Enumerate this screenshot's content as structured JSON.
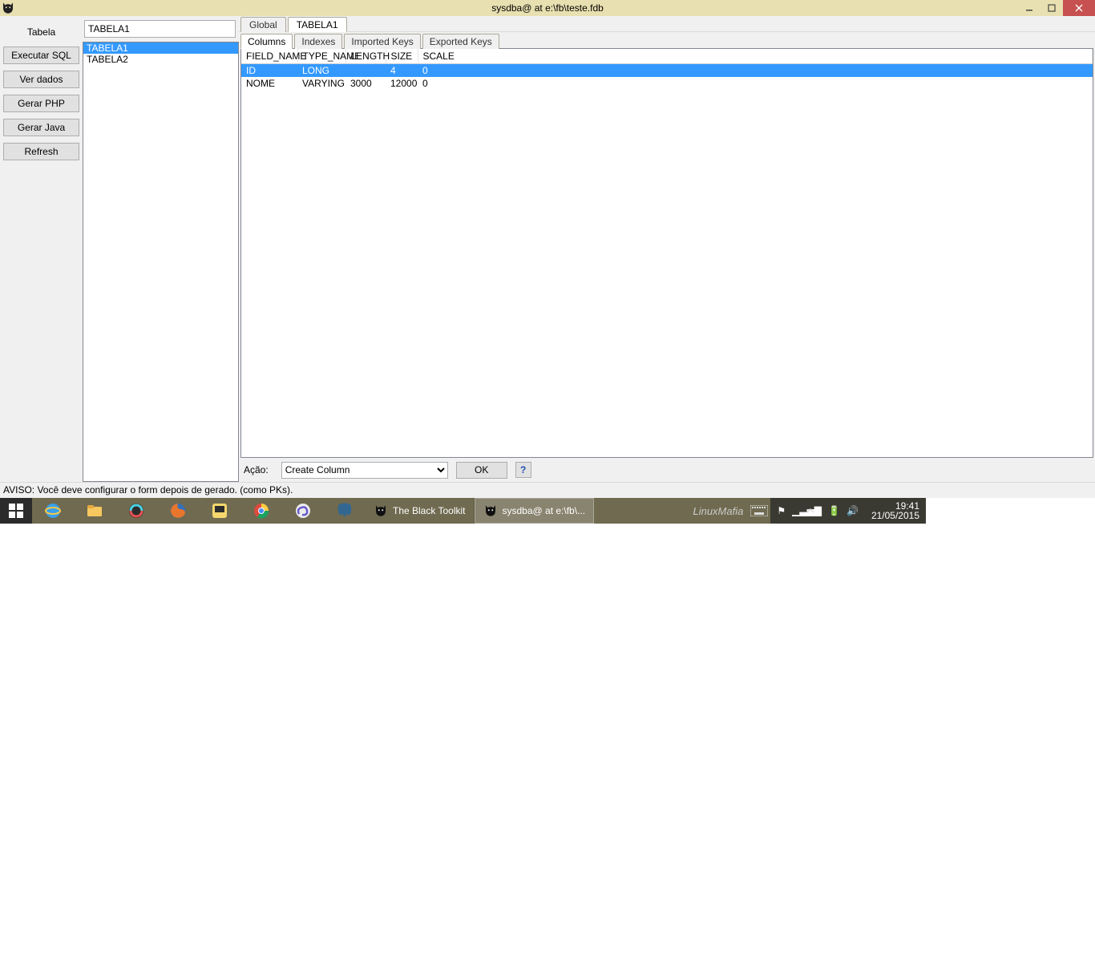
{
  "window": {
    "title": "sysdba@ at e:\\fb\\teste.fdb"
  },
  "sidebar": {
    "label": "Tabela",
    "buttons": {
      "executar_sql": "Executar SQL",
      "ver_dados": "Ver dados",
      "gerar_php": "Gerar PHP",
      "gerar_java": "Gerar Java",
      "refresh": "Refresh"
    }
  },
  "table_input": {
    "value": "TABELA1"
  },
  "table_list": {
    "items": [
      "TABELA1",
      "TABELA2"
    ],
    "selected_index": 0
  },
  "main_tabs": {
    "items": [
      "Global",
      "TABELA1"
    ],
    "active_index": 1
  },
  "sub_tabs": {
    "items": [
      "Columns",
      "Indexes",
      "Imported Keys",
      "Exported Keys"
    ],
    "active_index": 0
  },
  "grid": {
    "headers": [
      "FIELD_NAME",
      "TYPE_NAME",
      "LENGTH",
      "SIZE",
      "SCALE"
    ],
    "rows": [
      {
        "field": "ID",
        "type": "LONG",
        "length": "",
        "size": "4",
        "scale": "0",
        "selected": true
      },
      {
        "field": "NOME",
        "type": "VARYING",
        "length": "3000",
        "size": "12000",
        "scale": "0",
        "selected": false
      }
    ]
  },
  "action": {
    "label": "Ação:",
    "select_value": "Create Column",
    "ok_label": "OK",
    "help_label": "?"
  },
  "status": {
    "text": "AVISO: Você deve configurar o form depois de gerado. (como PKs)."
  },
  "taskbar": {
    "task1": "The Black Toolkit",
    "task2": "sysdba@ at e:\\fb\\...",
    "time": "19:41",
    "date": "21/05/2015",
    "brand": "LinuxMafia"
  }
}
